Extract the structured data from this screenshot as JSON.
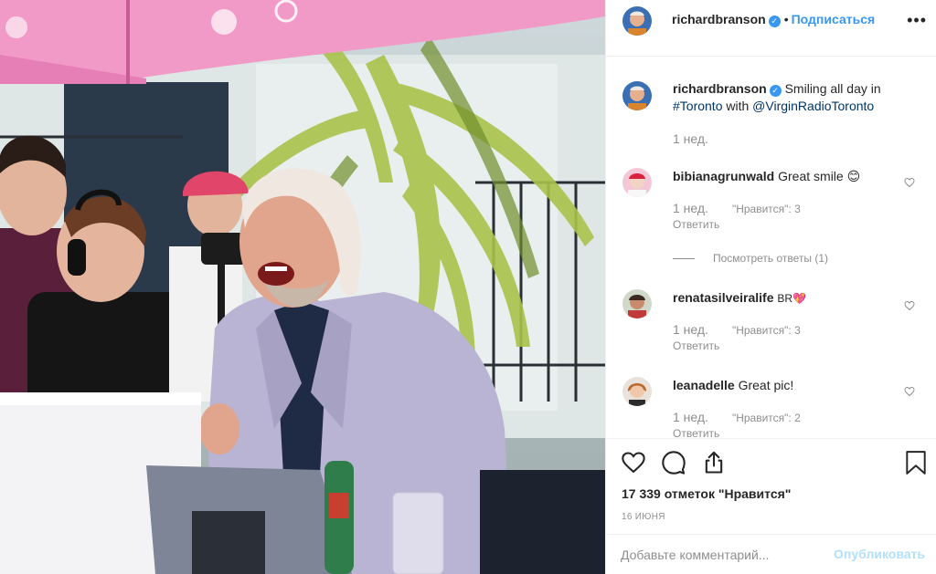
{
  "post": {
    "author": "richardbranson",
    "follow_label": "Подписаться",
    "more_label": "•••"
  },
  "caption": {
    "author": "richardbranson",
    "text_plain": "Smiling all day in",
    "hashtag": "#Toronto",
    "text_mid": "with",
    "mention": "@VirginRadioToronto",
    "time": "1 нед."
  },
  "comments": [
    {
      "author": "bibianagrunwald",
      "text": "Great smile 😊",
      "time": "1 нед.",
      "likes": "\"Нравится\": 3",
      "reply": "Ответить"
    },
    {
      "author": "renatasilveiralife",
      "text": "BR💖",
      "time": "1 нед.",
      "likes": "\"Нравится\": 3",
      "reply": "Ответить"
    },
    {
      "author": "leanadelle",
      "text": "Great pic!",
      "time": "1 нед.",
      "likes": "\"Нравится\": 2",
      "reply": "Ответить"
    }
  ],
  "view_replies": "Посмотреть ответы (1)",
  "likes_count": "17 339 отметок \"Нравится\"",
  "date": "16 ИЮНЯ",
  "comment_box": {
    "placeholder": "Добавьте комментарий...",
    "publish_label": "Опубликовать"
  },
  "colors": {
    "accent": "#3897f0",
    "muted": "#8e8e8e",
    "publish_disabled": "#b2dffc"
  },
  "icons": [
    "verified-badge-icon",
    "heart-icon",
    "comment-icon",
    "share-icon",
    "bookmark-icon",
    "small-heart-icon"
  ]
}
